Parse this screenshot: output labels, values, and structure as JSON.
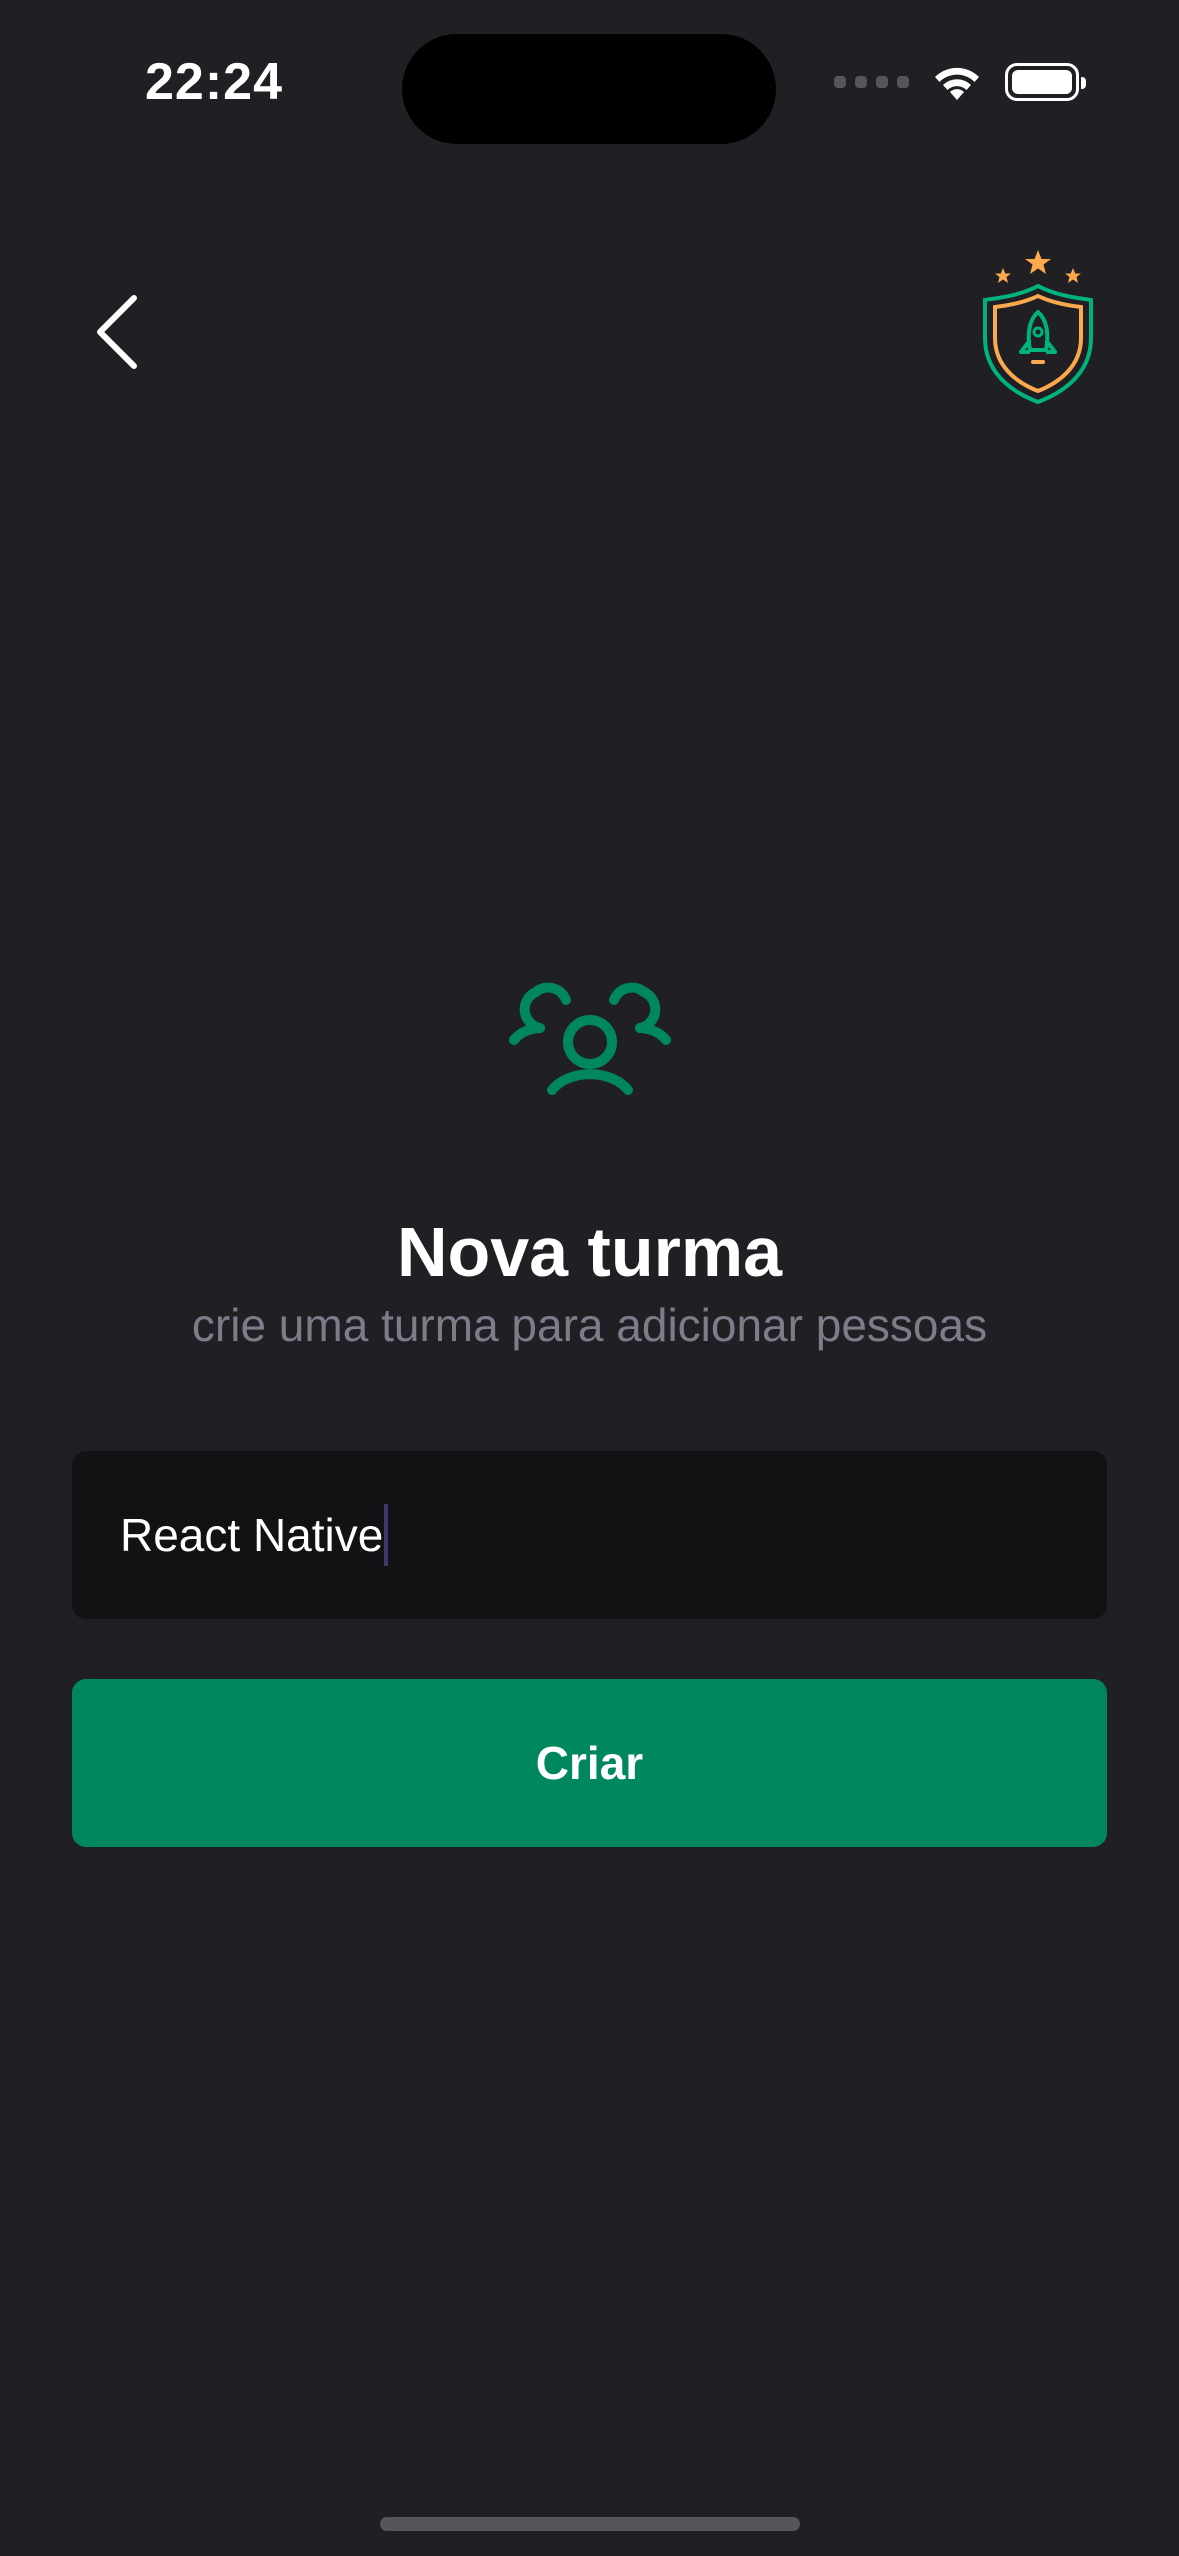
{
  "status_bar": {
    "time": "22:24",
    "icons": [
      "signal-icon",
      "wifi-icon",
      "battery-icon"
    ]
  },
  "header": {
    "back_icon": "chevron-left-icon",
    "logo_icon": "shield-rocket-logo-icon"
  },
  "main": {
    "icon": "users-three-icon",
    "title": "Nova turma",
    "subtitle": "crie uma turma para adicionar pessoas",
    "input": {
      "value": "React Native"
    },
    "button_label": "Criar"
  },
  "colors": {
    "background": "#202024",
    "input_background": "#121214",
    "accent_green": "#00875F",
    "logo_orange": "#FBA94C",
    "subtitle_gray": "#7C7C8A"
  }
}
